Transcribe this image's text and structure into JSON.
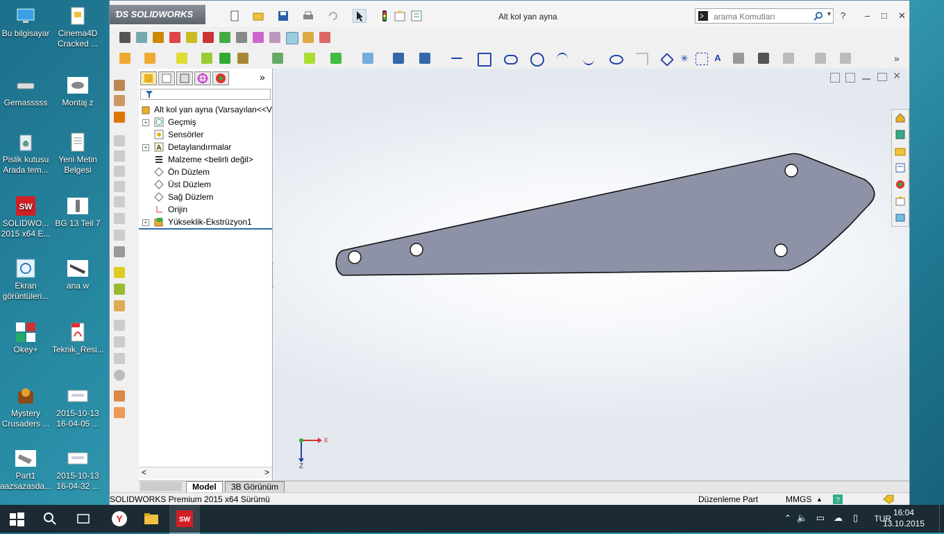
{
  "desktop": {
    "icons": [
      {
        "label": "Bu bilgisayar"
      },
      {
        "label": "Cinema4D Cracked ..."
      },
      {
        "label": "Gemasssss"
      },
      {
        "label": "Montaj z"
      },
      {
        "label": "Pislik kutusu Arada tem..."
      },
      {
        "label": "Yeni Metin Belgesi"
      },
      {
        "label": "SOLIDWO... 2015 x64 E..."
      },
      {
        "label": "BG 13 Teil 7"
      },
      {
        "label": "Ekran görüntüleri..."
      },
      {
        "label": "ana w"
      },
      {
        "label": "Okey+"
      },
      {
        "label": "Teknik_Resi..."
      },
      {
        "label": "Mystery Crusaders ..."
      },
      {
        "label": "2015-10-13 16-04-05 ..."
      },
      {
        "label": "Part1 aazsazasda..."
      },
      {
        "label": "2015-10-13 16-04-32 ..."
      }
    ]
  },
  "app": {
    "logo": "SOLIDWORKS",
    "document_title": "Alt kol yan ayna",
    "search_placeholder": "arama Komutları",
    "help": "?",
    "minimize": "–",
    "maximize": "□",
    "close": "✕"
  },
  "feature_manager": {
    "root": "Alt kol yan ayna  (Varsayılan<<V",
    "items": [
      {
        "label": "Geçmiş"
      },
      {
        "label": "Sensörler"
      },
      {
        "label": "Detaylandırmalar"
      },
      {
        "label": "Malzeme <belirli değil>"
      },
      {
        "label": "Ön Düzlem"
      },
      {
        "label": "Üst Düzlem"
      },
      {
        "label": "Sağ Düzlem"
      },
      {
        "label": "Orijin"
      },
      {
        "label": "Yükseklik-Ekstrüzyon1"
      }
    ],
    "scroll_left": "<",
    "scroll_right": ">"
  },
  "triad": {
    "x": "X",
    "z": "Z"
  },
  "bottom_tabs": [
    {
      "label": "Model"
    },
    {
      "label": "3B Görünüm"
    }
  ],
  "status": {
    "product": "SOLIDWORKS Premium 2015 x64 Sürümü",
    "mode": "Düzenleme Part",
    "units": "MMGS"
  },
  "taskbar": {
    "lang": "TUR",
    "time": "16:04",
    "date": "13.10.2015"
  },
  "colors": {
    "part_fill": "#8d92a6",
    "accent": "#2d6aa8"
  }
}
